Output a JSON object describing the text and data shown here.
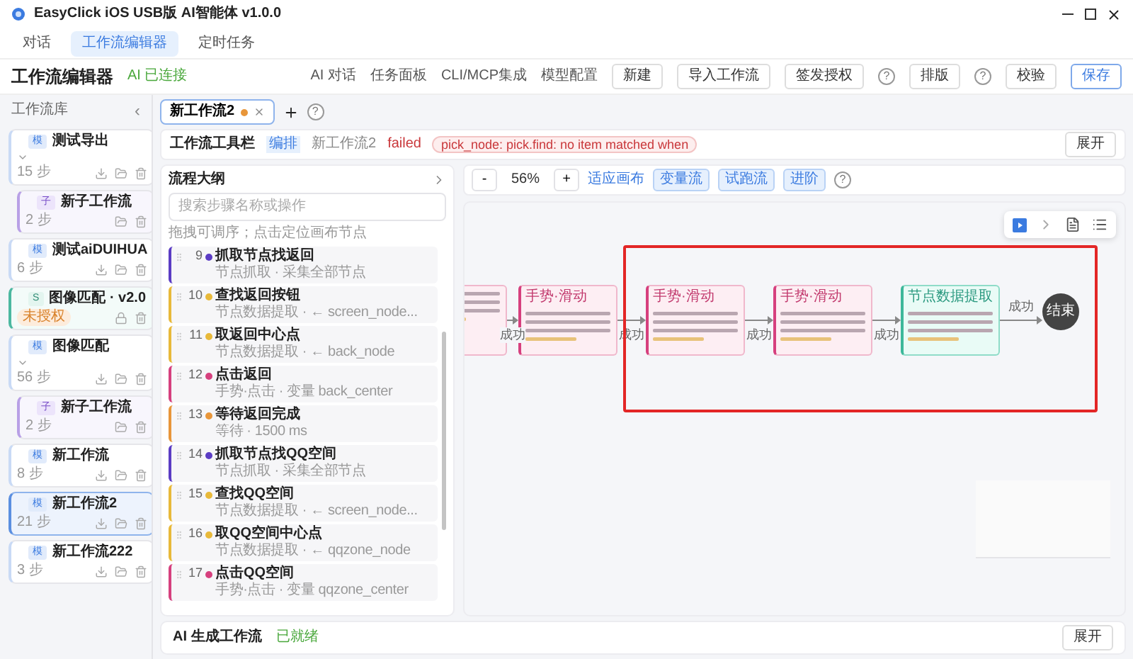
{
  "window": {
    "title": "EasyClick iOS USB版 AI智能体 v1.0.0"
  },
  "main_tabs": [
    {
      "label": "对话",
      "selected": false
    },
    {
      "label": "工作流编辑器",
      "selected": true
    },
    {
      "label": "定时任务",
      "selected": false
    }
  ],
  "header": {
    "title": "工作流编辑器",
    "status": "AI 已连接",
    "links": [
      "AI 对话",
      "任务面板",
      "CLI/MCP集成",
      "模型配置"
    ],
    "buttons": [
      {
        "kind": "button",
        "label": "新建"
      },
      {
        "kind": "button",
        "label": "导入工作流"
      },
      {
        "kind": "button",
        "label": "签发授权"
      },
      {
        "kind": "help",
        "label": "?"
      },
      {
        "kind": "button",
        "label": "排版"
      },
      {
        "kind": "help",
        "label": "?"
      },
      {
        "kind": "button",
        "label": "校验"
      },
      {
        "kind": "primary",
        "label": "保存"
      }
    ]
  },
  "sidebar": {
    "title": "工作流库",
    "collapse": "‹",
    "items": [
      {
        "kind": "workflow",
        "badge": "模",
        "name": "测试导出",
        "steps": "15 步",
        "selected": false,
        "expanded": true,
        "children": [
          {
            "kind": "sub",
            "badge": "子",
            "name": "新子工作流",
            "steps": "2 步",
            "selected": false
          }
        ]
      },
      {
        "kind": "workflow",
        "badge": "模",
        "name": "测试aiDUIHUA",
        "steps": "6 步",
        "selected": false
      },
      {
        "kind": "skill",
        "badge": "S",
        "name": "图像匹配 · v2.0",
        "tag": "未授权",
        "selected": false
      },
      {
        "kind": "workflow",
        "badge": "模",
        "name": "图像匹配",
        "steps": "56 步",
        "selected": false,
        "expanded": true,
        "children": [
          {
            "kind": "sub",
            "badge": "子",
            "name": "新子工作流",
            "steps": "2 步",
            "selected": false
          }
        ]
      },
      {
        "kind": "workflow",
        "badge": "模",
        "name": "新工作流",
        "steps": "8 步",
        "selected": false
      },
      {
        "kind": "workflow",
        "badge": "模",
        "name": "新工作流2",
        "steps": "21 步",
        "selected": true
      },
      {
        "kind": "workflow",
        "badge": "模",
        "name": "新工作流222",
        "steps": "3 步",
        "selected": false
      }
    ]
  },
  "editor_tabs": [
    {
      "label": "新工作流2",
      "modified": true,
      "selected": true
    }
  ],
  "toolbar": {
    "title": "工作流工具栏",
    "mode": "编排",
    "name": "新工作流2",
    "status": "failed",
    "error": "pick_node: pick.find: no item matched when",
    "expand": "展开"
  },
  "outline": {
    "title": "流程大纲",
    "search": {
      "placeholder": "搜索步骤名称或操作"
    },
    "hint": "拖拽可调序；点击定位画布节点",
    "items": [
      {
        "num": "9",
        "color": "#5b3cc4",
        "title": "抓取节点找返回",
        "subtitle": "节点抓取 · 采集全部节点"
      },
      {
        "num": "10",
        "color": "#e8b93a",
        "title": "查找返回按钮",
        "subtitle": "节点数据提取 · ← screen_node..."
      },
      {
        "num": "11",
        "color": "#e8b93a",
        "title": "取返回中心点",
        "subtitle": "节点数据提取 · ← back_node"
      },
      {
        "num": "12",
        "color": "#d6407e",
        "title": "点击返回",
        "subtitle": "手势·点击 · 变量 back_center"
      },
      {
        "num": "13",
        "color": "#e8963a",
        "title": "等待返回完成",
        "subtitle": "等待 · 1500 ms"
      },
      {
        "num": "14",
        "color": "#5b3cc4",
        "title": "抓取节点找QQ空间",
        "subtitle": "节点抓取 · 采集全部节点"
      },
      {
        "num": "15",
        "color": "#e8b93a",
        "title": "查找QQ空间",
        "subtitle": "节点数据提取 · ← screen_node..."
      },
      {
        "num": "16",
        "color": "#e8b93a",
        "title": "取QQ空间中心点",
        "subtitle": "节点数据提取 · ← qqzone_node"
      },
      {
        "num": "17",
        "color": "#d6407e",
        "title": "点击QQ空间",
        "subtitle": "手势·点击 · 变量 qqzone_center"
      }
    ]
  },
  "canvas": {
    "zoom": "56%",
    "zoom_out": "-",
    "zoom_in": "+",
    "fit": "适应画布",
    "modes": [
      {
        "label": "变量流",
        "on": true
      },
      {
        "label": "试跑流",
        "on": true
      },
      {
        "label": "进阶",
        "on": true
      }
    ],
    "nodes": [
      {
        "kind": "gesture"
      },
      {
        "kind": "gesture",
        "title": "手势·滑动"
      },
      {
        "kind": "gesture",
        "title": "手势·滑动"
      },
      {
        "kind": "gesture",
        "title": "手势·滑动"
      },
      {
        "kind": "extract",
        "title": "节点数据提取"
      },
      {
        "kind": "end",
        "title": "结束"
      }
    ],
    "edge_labels": [
      "成功",
      "成功",
      "成功",
      "成功",
      "成功"
    ]
  },
  "ai_panel": {
    "title": "AI 生成工作流",
    "status": "已就绪",
    "expand": "展开"
  }
}
